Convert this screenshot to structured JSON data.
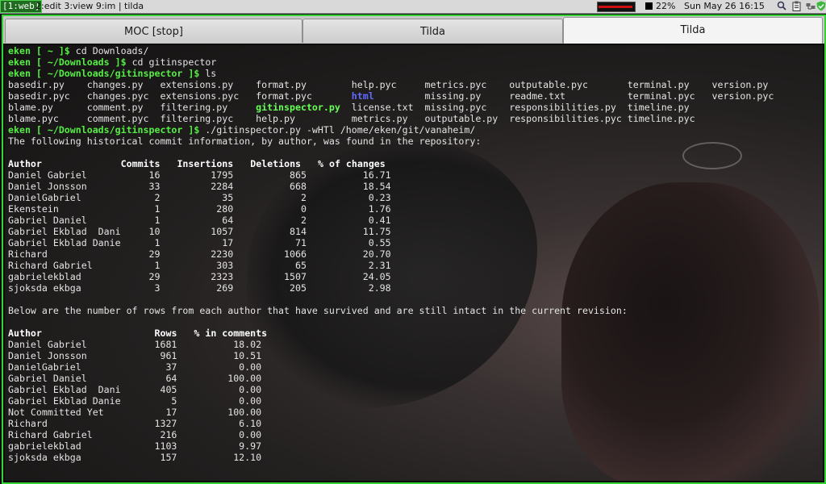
{
  "topbar": {
    "active_workspace": "[1:web]",
    "other_workspaces": " 2:edit 3:view 9:im | tilda",
    "battery_fraction": 0.95,
    "battery_percent": "22%",
    "clock": "Sun May 26 16:15"
  },
  "tabs": [
    "MOC [stop]",
    "Tilda",
    "Tilda"
  ],
  "terminal": {
    "lines": [
      [
        {
          "t": "eken [ ~ ]$",
          "c": "g"
        },
        {
          "t": " cd Downloads/"
        }
      ],
      [
        {
          "t": "eken [ ~/Downloads ]$",
          "c": "g"
        },
        {
          "t": " cd gitinspector"
        }
      ],
      [
        {
          "t": "eken [ ~/Downloads/gitinspector ]$",
          "c": "g"
        },
        {
          "t": " ls"
        }
      ],
      [
        {
          "t": "basedir.py    changes.py   extensions.py    format.py        help.pyc     metrics.pyc    outputable.pyc       terminal.py    version.py"
        }
      ],
      [
        {
          "t": "basedir.pyc   changes.pyc  extensions.pyc   format.pyc       "
        },
        {
          "t": "html",
          "c": "b"
        },
        {
          "t": "         missing.py     readme.txt           terminal.pyc   version.pyc"
        }
      ],
      [
        {
          "t": "blame.py      comment.py   filtering.py     "
        },
        {
          "t": "gitinspector.py",
          "c": "bgrn"
        },
        {
          "t": "  license.txt  missing.pyc    responsibilities.py  timeline.py"
        }
      ],
      [
        {
          "t": "blame.pyc     comment.pyc  filtering.pyc    help.py          metrics.py   outputable.py  responsibilities.pyc timeline.pyc"
        }
      ],
      [
        {
          "t": "eken [ ~/Downloads/gitinspector ]$",
          "c": "g"
        },
        {
          "t": " ./gitinspector.py -wHTl /home/eken/git/vanaheim/"
        }
      ],
      [
        {
          "t": "The following historical commit information, by author, was found in the repository:"
        }
      ],
      [
        {
          "t": ""
        }
      ],
      [
        {
          "t": "Author",
          "c": "bold"
        },
        {
          "t": "              "
        },
        {
          "t": "Commits",
          "c": "bold"
        },
        {
          "t": "   "
        },
        {
          "t": "Insertions",
          "c": "bold"
        },
        {
          "t": "   "
        },
        {
          "t": "Deletions",
          "c": "bold"
        },
        {
          "t": "   "
        },
        {
          "t": "% of changes",
          "c": "bold"
        }
      ],
      [
        {
          "t": "Daniel Gabriel           16         1795          865          16.71"
        }
      ],
      [
        {
          "t": "Daniel Jonsson           33         2284          668          18.54"
        }
      ],
      [
        {
          "t": "DanielGabriel             2           35            2           0.23"
        }
      ],
      [
        {
          "t": "Ekenstein                 1          280            0           1.76"
        }
      ],
      [
        {
          "t": "Gabriel Daniel            1           64            2           0.41"
        }
      ],
      [
        {
          "t": "Gabriel Ekblad  Dani     10         1057          814          11.75"
        }
      ],
      [
        {
          "t": "Gabriel Ekblad Danie      1           17           71           0.55"
        }
      ],
      [
        {
          "t": "Richard                  29         2230         1066          20.70"
        }
      ],
      [
        {
          "t": "Richard Gabriel           1          303           65           2.31"
        }
      ],
      [
        {
          "t": "gabrielekblad            29         2323         1507          24.05"
        }
      ],
      [
        {
          "t": "sjoksda ekbga             3          269          205           2.98"
        }
      ],
      [
        {
          "t": ""
        }
      ],
      [
        {
          "t": "Below are the number of rows from each author that have survived and are still intact in the current revision:"
        }
      ],
      [
        {
          "t": ""
        }
      ],
      [
        {
          "t": "Author",
          "c": "bold"
        },
        {
          "t": "                    "
        },
        {
          "t": "Rows",
          "c": "bold"
        },
        {
          "t": "   "
        },
        {
          "t": "% in comments",
          "c": "bold"
        }
      ],
      [
        {
          "t": "Daniel Gabriel            1681          18.02"
        }
      ],
      [
        {
          "t": "Daniel Jonsson             961          10.51"
        }
      ],
      [
        {
          "t": "DanielGabriel               37           0.00"
        }
      ],
      [
        {
          "t": "Gabriel Daniel              64         100.00"
        }
      ],
      [
        {
          "t": "Gabriel Ekblad  Dani       405           0.00"
        }
      ],
      [
        {
          "t": "Gabriel Ekblad Danie         5           0.00"
        }
      ],
      [
        {
          "t": "Not Committed Yet           17         100.00"
        }
      ],
      [
        {
          "t": "Richard                   1327           6.10"
        }
      ],
      [
        {
          "t": "Richard Gabriel            216           0.00"
        }
      ],
      [
        {
          "t": "gabrielekblad             1103           9.97"
        }
      ],
      [
        {
          "t": "sjoksda ekbga              157          12.10"
        }
      ]
    ]
  },
  "colors": {
    "frame_border": "#35d335",
    "prompt": "#55ee44",
    "directory": "#5f6cff",
    "executable": "#66ff55",
    "battery": "#d01010"
  }
}
